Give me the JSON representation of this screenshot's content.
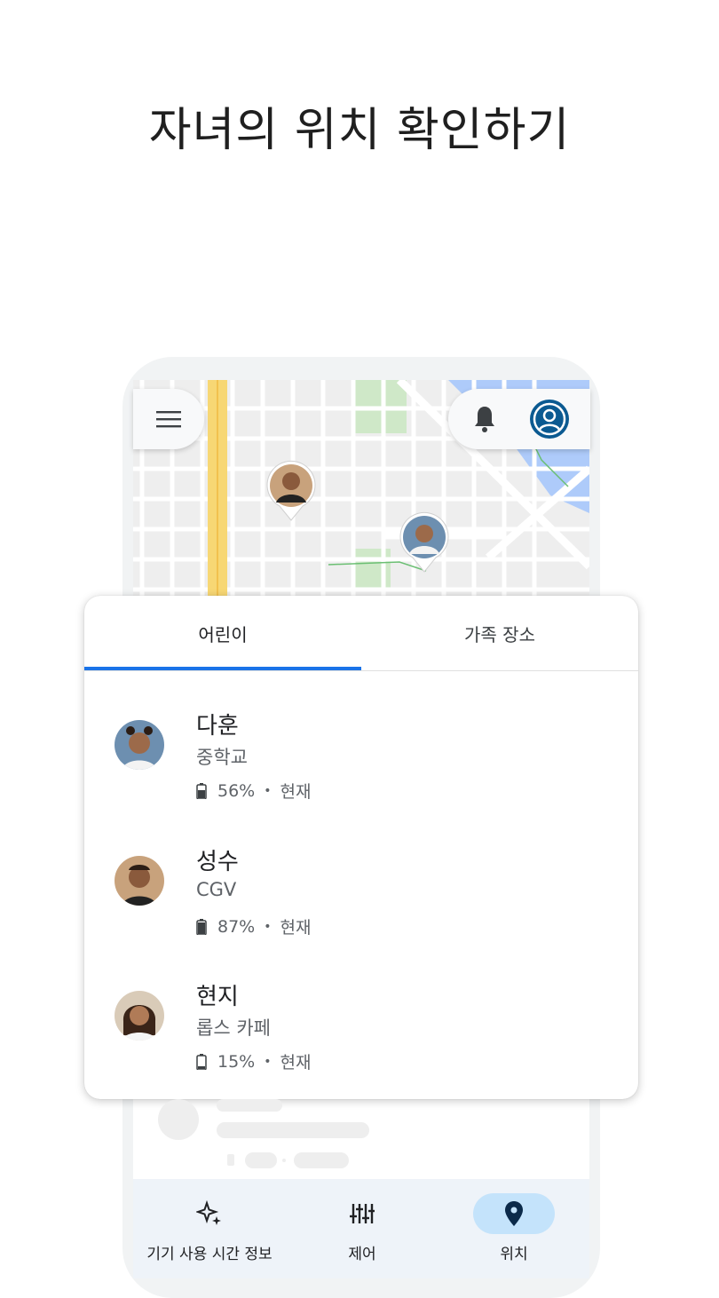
{
  "headline": "자녀의 위치 확인하기",
  "top_bar": {
    "menu_icon": "menu-icon",
    "notification_icon": "bell-icon",
    "account_icon": "account-circle-icon"
  },
  "colors": {
    "accent": "#1a73e8",
    "account_bg": "#0b5a91",
    "nav_active_bg": "#c4e3fb",
    "nav_bg": "#eef3f9",
    "map_road_highlight": "#f7d774",
    "map_water": "#aecbfa",
    "map_park": "#cfe8c8"
  },
  "tabs": [
    {
      "label": "어린이",
      "active": true
    },
    {
      "label": "가족 장소",
      "active": false
    }
  ],
  "children": [
    {
      "name": "다훈",
      "place": "중학교",
      "battery": "56%",
      "time": "현재"
    },
    {
      "name": "성수",
      "place": "CGV",
      "battery": "87%",
      "time": "현재"
    },
    {
      "name": "현지",
      "place": "롭스 카페",
      "battery": "15%",
      "time": "현재"
    }
  ],
  "status_separator": "•",
  "bottom_nav": [
    {
      "label": "기기 사용 시간 정보",
      "icon": "sparkle-icon",
      "active": false
    },
    {
      "label": "제어",
      "icon": "sliders-icon",
      "active": false
    },
    {
      "label": "위치",
      "icon": "location-pin-icon",
      "active": true
    }
  ]
}
